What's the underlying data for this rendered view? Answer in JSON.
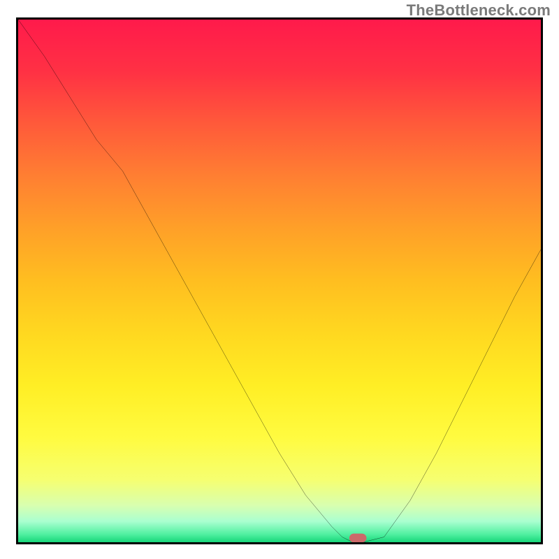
{
  "attribution": "TheBottleneck.com",
  "chart_data": {
    "type": "line",
    "title": "",
    "xlabel": "",
    "ylabel": "",
    "xlim": [
      0,
      100
    ],
    "ylim": [
      0,
      100
    ],
    "x": [
      0,
      5,
      10,
      15,
      20,
      25,
      30,
      35,
      40,
      45,
      50,
      55,
      60,
      62,
      64,
      66,
      70,
      75,
      80,
      85,
      90,
      95,
      100
    ],
    "values": [
      100,
      93,
      85,
      77,
      71,
      62,
      53,
      44,
      35,
      26,
      17,
      9,
      3,
      1,
      0,
      0,
      1,
      8,
      17,
      27,
      37,
      47,
      56
    ],
    "gradient_stops": [
      {
        "pos": 0.0,
        "color": "#ff1a4b"
      },
      {
        "pos": 0.1,
        "color": "#ff3144"
      },
      {
        "pos": 0.2,
        "color": "#ff5a3a"
      },
      {
        "pos": 0.3,
        "color": "#ff7f32"
      },
      {
        "pos": 0.4,
        "color": "#ffa028"
      },
      {
        "pos": 0.5,
        "color": "#ffbe20"
      },
      {
        "pos": 0.6,
        "color": "#ffd820"
      },
      {
        "pos": 0.7,
        "color": "#ffee25"
      },
      {
        "pos": 0.8,
        "color": "#fffb40"
      },
      {
        "pos": 0.88,
        "color": "#f6ff70"
      },
      {
        "pos": 0.93,
        "color": "#d8ffb0"
      },
      {
        "pos": 0.96,
        "color": "#aaffd0"
      },
      {
        "pos": 0.985,
        "color": "#50f0a0"
      },
      {
        "pos": 1.0,
        "color": "#18d67a"
      }
    ],
    "marker": {
      "x": 65,
      "y": 0.8,
      "color": "#cc6a6a"
    }
  }
}
